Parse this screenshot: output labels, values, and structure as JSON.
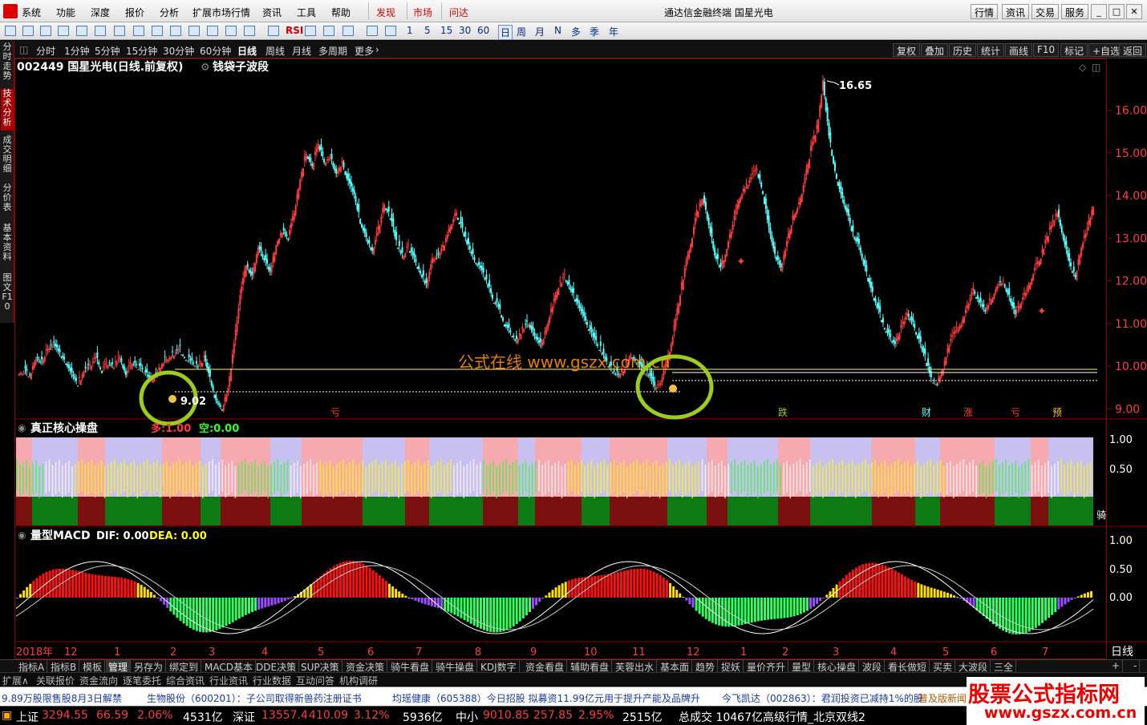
{
  "menu": {
    "items": [
      "系统",
      "功能",
      "深度",
      "报价",
      "分析",
      "扩展市场行情",
      "资讯",
      "工具",
      "帮助"
    ],
    "hot": [
      "发现",
      "市场",
      "问达"
    ],
    "title": "通达信金融终端  国星光电",
    "right": [
      "行情",
      "资讯",
      "交易",
      "服务"
    ]
  },
  "toolbar": {
    "periods": [
      "1",
      "5",
      "15",
      "30",
      "60"
    ],
    "cal": [
      "日",
      "周",
      "月",
      "N",
      "多",
      "季",
      "年"
    ]
  },
  "left_tabs": [
    "分时走势",
    "技术分析",
    "成交明细",
    "分价表",
    "基本资料",
    "图文F10"
  ],
  "period_tabs": [
    "分时",
    "1分钟",
    "5分钟",
    "15分钟",
    "30分钟",
    "60分钟",
    "日线",
    "周线",
    "月线",
    "多周期",
    "更多"
  ],
  "right_tabs": [
    "复权",
    "叠加",
    "历史",
    "统计",
    "画线",
    "F10",
    "标记",
    "+自选",
    "返回"
  ],
  "stock": {
    "header": "002449 国星光电(日线.前复权)",
    "indicator": "钱袋子波段",
    "high_label": "16.65",
    "low_label": "9.02",
    "watermark": "公式在线 www.gszx.com.cn",
    "axis": [
      "16.00",
      "15.00",
      "14.00",
      "13.00",
      "12.00",
      "11.00",
      "10.00",
      "9.00"
    ],
    "markers": [
      "亏",
      "跌",
      "财",
      "涨",
      "亏",
      "预"
    ]
  },
  "panel2": {
    "title": "真正核心操盘",
    "duo": "多:1.00",
    "kong": "空:0.00",
    "axis": [
      "1.00",
      "0.50"
    ],
    "tag": "骑"
  },
  "panel3": {
    "title": "量型MACD",
    "dif": "DIF: 0.00",
    "dea": "DEA: 0.00",
    "axis": [
      "1.00",
      "0.50",
      "0.00"
    ]
  },
  "time_axis": [
    "2018年",
    "12",
    "1",
    "2",
    "3",
    "4",
    "5",
    "6",
    "7",
    "8",
    "9",
    "10",
    "11",
    "12",
    "1",
    "2",
    "3",
    "4",
    "5",
    "6",
    "7"
  ],
  "time_corner": "日线",
  "bottom_tabs": [
    "指标A",
    "指标B",
    "模板",
    "管理",
    "另存为",
    "绑定到",
    "MACD基本",
    "DDE决策",
    "SUP决策",
    "资金决策",
    "骑牛看盘",
    "骑牛操盘",
    "KDJ数字",
    "资金看盘",
    "辅助看盘",
    "芙蓉出水",
    "基本面",
    "趋势",
    "捉妖",
    "量价齐升",
    "量型",
    "核心操盘",
    "波段",
    "看长做短",
    "买卖",
    "大波段",
    "三全"
  ],
  "bottom_tabs2": [
    "扩展∧",
    "关联报价",
    "资金流向",
    "逐笔委托",
    "综合资讯",
    "行业资讯",
    "行业数据",
    "互动问答",
    "机构调研"
  ],
  "news": [
    "9.89万股限售股8月3日解禁",
    "生物股份（600201）：子公司取得新兽药注册证书",
    "均瑶健康（605388）今日招股  拟募资11.99亿元用于提升产能及品牌升",
    "今飞凯达（002863）：君润投资已减持1%的股",
    "普及版新闻"
  ],
  "status": [
    {
      "name": "上证",
      "price": "3294.55",
      "chg": "66.59",
      "pct": "2.06%",
      "amt": "4531亿"
    },
    {
      "name": "深证",
      "price": "13557.4",
      "chg": "410.09",
      "pct": "3.12%",
      "amt": "5936亿"
    },
    {
      "name": "中小",
      "price": "9010.85",
      "chg": "257.85",
      "pct": "2.95%",
      "amt": "2515亿"
    }
  ],
  "total": "总成交  10467亿高级行情_北京双线2",
  "watermark": {
    "line1": "股票公式指标网",
    "line2": "www.gszx.com.cn"
  },
  "colors": {
    "up": "#ff3b3b",
    "down": "#54ffff",
    "yellow": "#ffff00",
    "circle": "#9ccc1c"
  },
  "chart_data": {
    "type": "candlestick",
    "symbol": "002449",
    "name": "国星光电",
    "period": "日线",
    "high": 16.65,
    "low": 9.02,
    "ylim": [
      8.8,
      16.8
    ],
    "closes": [
      9.9,
      9.8,
      10.2,
      10.1,
      10.4,
      10.5,
      10.3,
      10.1,
      9.8,
      9.6,
      9.9,
      10.0,
      10.2,
      9.9,
      10.1,
      10.0,
      10.2,
      9.8,
      10.1,
      10.0,
      9.9,
      9.7,
      9.8,
      10.1,
      10.2,
      10.3,
      10.4,
      10.2,
      10.1,
      10.0,
      10.2,
      9.7,
      9.2,
      9.02,
      9.5,
      10.5,
      11.6,
      12.4,
      12.1,
      12.8,
      12.5,
      12.2,
      12.9,
      13.2,
      13.0,
      13.6,
      14.4,
      15.0,
      14.7,
      15.2,
      14.8,
      14.9,
      14.5,
      14.8,
      14.3,
      14.0,
      13.4,
      13.0,
      12.7,
      13.2,
      13.8,
      13.5,
      12.9,
      12.6,
      12.8,
      12.5,
      12.2,
      11.9,
      12.5,
      12.6,
      12.9,
      13.3,
      13.6,
      13.2,
      12.8,
      12.5,
      12.3,
      12.0,
      11.6,
      11.4,
      11.0,
      10.8,
      10.6,
      10.9,
      11.0,
      10.7,
      10.5,
      10.9,
      11.4,
      11.9,
      12.1,
      11.8,
      11.5,
      11.2,
      10.9,
      10.6,
      10.4,
      10.1,
      9.9,
      9.8,
      10.0,
      10.3,
      10.1,
      9.9,
      9.8,
      9.5,
      9.6,
      10.1,
      10.7,
      11.5,
      12.3,
      12.9,
      13.6,
      14.0,
      13.3,
      12.6,
      12.3,
      12.8,
      13.3,
      13.9,
      14.2,
      14.4,
      14.6,
      14.1,
      13.2,
      12.6,
      12.3,
      12.9,
      13.5,
      13.8,
      14.4,
      15.1,
      15.6,
      16.65,
      15.4,
      14.6,
      14.0,
      13.6,
      13.1,
      12.8,
      12.3,
      11.8,
      11.4,
      11.0,
      10.7,
      10.5,
      10.9,
      11.2,
      11.0,
      10.6,
      10.2,
      9.7,
      9.6,
      10.0,
      10.5,
      10.8,
      11.0,
      11.4,
      11.8,
      11.5,
      11.3,
      11.6,
      11.9,
      12.0,
      11.6,
      11.2,
      11.5,
      11.8,
      12.2,
      12.5,
      12.9,
      13.3,
      13.6,
      13.0,
      12.4,
      12.1,
      12.8,
      13.2,
      13.8
    ]
  }
}
